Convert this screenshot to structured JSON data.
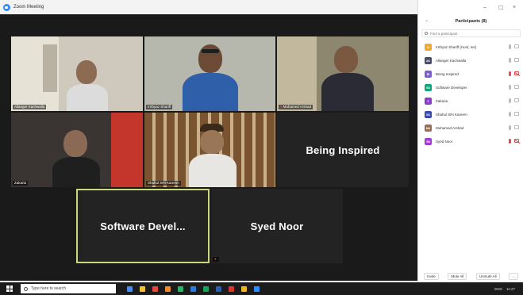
{
  "window": {
    "title": "Zoom Meeting"
  },
  "window_controls": {
    "minimize": "–",
    "maximize": "☐",
    "close": "×"
  },
  "tiles": [
    {
      "name": "Allanger Kachwalla"
    },
    {
      "name": "Irrthyaz Shariff"
    },
    {
      "name": "Mohamed Arshad"
    },
    {
      "name": "Zakaria"
    },
    {
      "name": "Shahul SRI Kareem"
    },
    {
      "big": "Being Inspired"
    },
    {
      "big": "Software Devel..."
    },
    {
      "big": "Syed Noor"
    }
  ],
  "panel": {
    "collapse": "⌄",
    "title": "Participants (8)",
    "search_placeholder": "Find a participant",
    "participants": [
      {
        "initials": "IS",
        "name": "Irrthyaz Shariff (Host, me)",
        "color": "#f5a623",
        "mic_muted": false,
        "cam_off": false
      },
      {
        "initials": "AK",
        "name": "Allanger Kachwalla",
        "color": "#4a4a6a",
        "mic_muted": false,
        "cam_off": false
      },
      {
        "initials": "BI",
        "name": "Being Inspired",
        "color": "#7b5cd6",
        "mic_muted": true,
        "cam_off": true
      },
      {
        "initials": "SD",
        "name": "Software Developer",
        "color": "#12a37c",
        "mic_muted": false,
        "cam_off": false
      },
      {
        "initials": "Z",
        "name": "Zakaria",
        "color": "#8b3bd1",
        "mic_muted": false,
        "cam_off": false
      },
      {
        "initials": "SS",
        "name": "Shahul SRI Kareem",
        "color": "#3a4aa8",
        "mic_muted": false,
        "cam_off": false
      },
      {
        "initials": "MA",
        "name": "Mohamed Arshad",
        "color": "#9a6a5a",
        "mic_muted": false,
        "cam_off": false
      },
      {
        "initials": "SN",
        "name": "Syed Noor",
        "color": "#a23bd1",
        "mic_muted": true,
        "cam_off": true
      }
    ],
    "footer": {
      "invite": "Invite",
      "mute_all": "Mute All",
      "unmute_all": "Unmute All",
      "more": "..."
    }
  },
  "taskbar": {
    "search_placeholder": "Type here to search",
    "lang": "ENG",
    "time": "11:27"
  }
}
